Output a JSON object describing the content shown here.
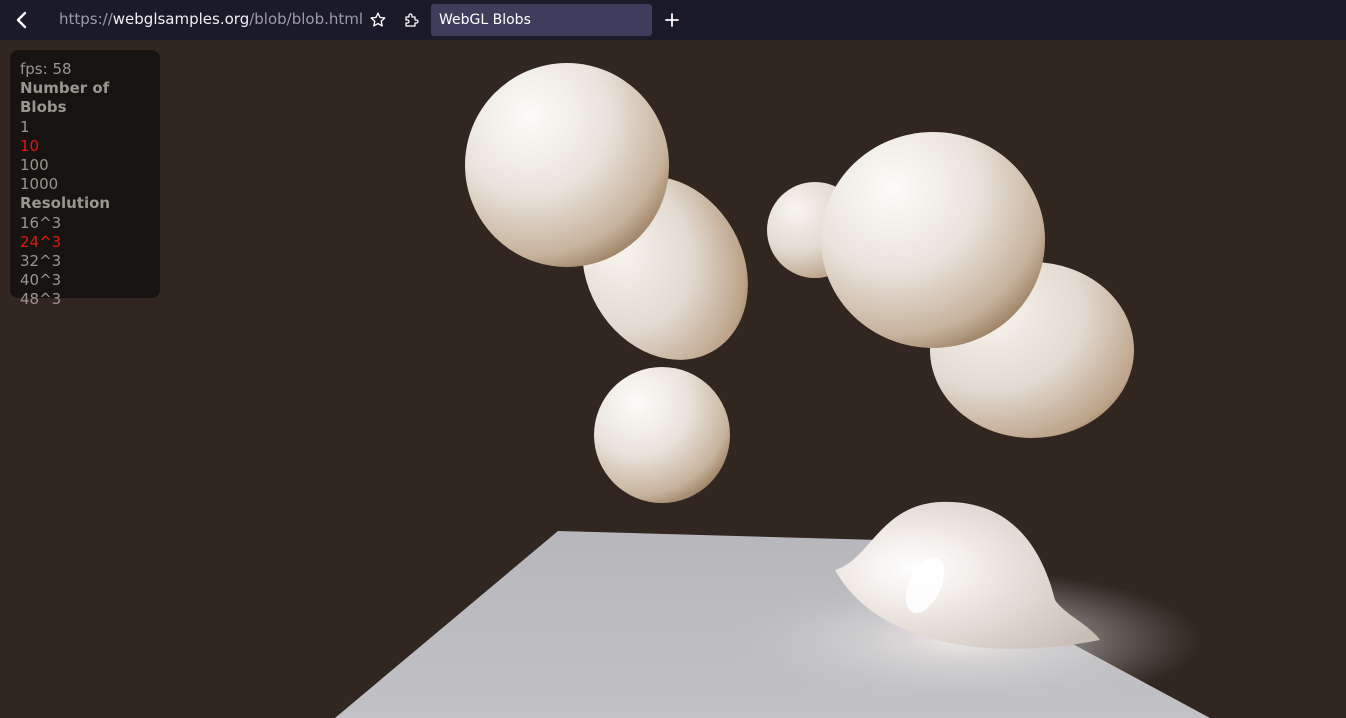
{
  "browser": {
    "url_scheme": "https://",
    "url_host": "webglsamples.org",
    "url_path": "/blob/blob.html",
    "tab_title": "WebGL Blobs"
  },
  "panel": {
    "fps": "fps: 58",
    "blobs_heading": "Number of Blobs",
    "blob_options": [
      "1",
      "10",
      "100",
      "1000"
    ],
    "blob_selected_index": 1,
    "resolution_heading": "Resolution",
    "resolution_options": [
      "16^3",
      "24^3",
      "32^3",
      "40^3",
      "48^3"
    ],
    "resolution_selected_index": 1
  },
  "colors": {
    "background": "#322620",
    "toolbar": "#1b1a29",
    "tab": "#3f3d5c",
    "selected_option": "#e01a10",
    "option_text": "#9a958f",
    "floor": "#b8b8bc",
    "blob": "#e8e2dc"
  },
  "icons": {
    "back": "chevron-left-icon",
    "bookmark": "star-icon",
    "extensions": "puzzle-icon",
    "new_tab": "plus-icon"
  }
}
